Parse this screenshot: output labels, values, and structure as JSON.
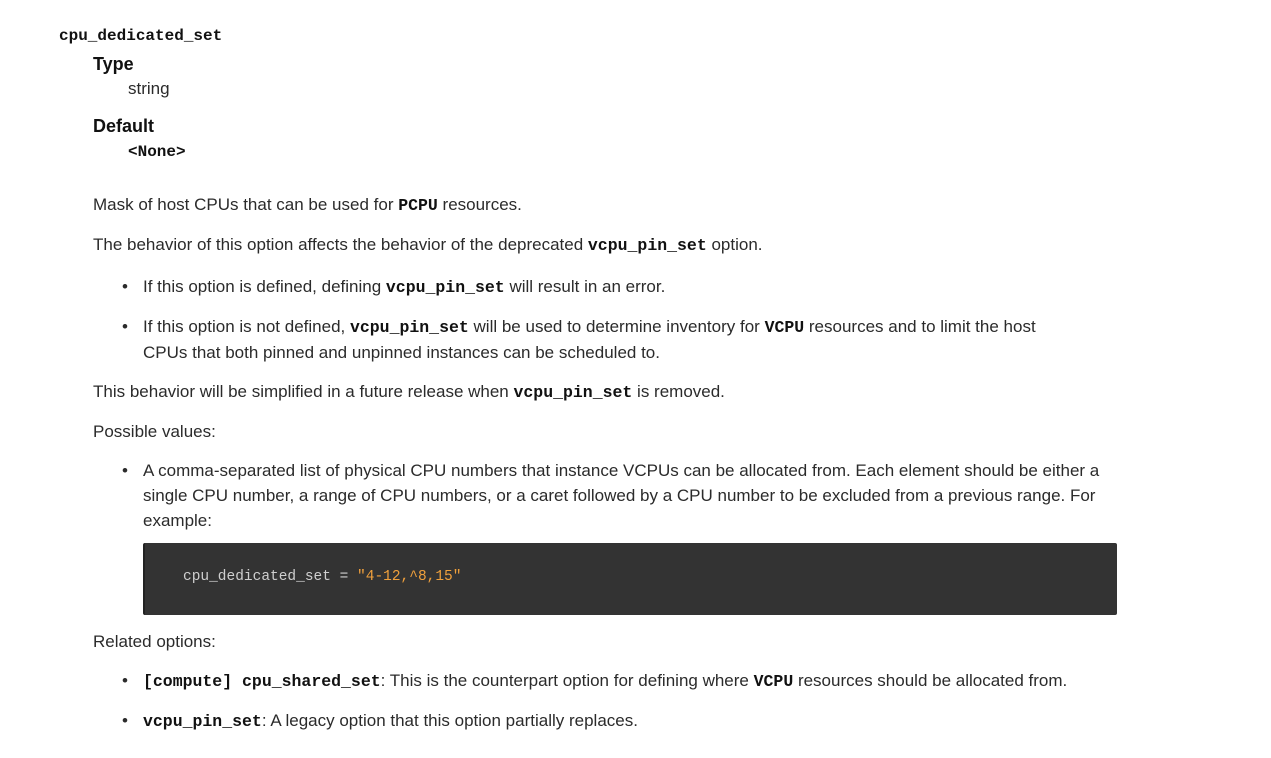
{
  "option": {
    "name": "cpu_dedicated_set",
    "type_label": "Type",
    "type_value": "string",
    "default_label": "Default",
    "default_value": "<None>"
  },
  "para1": {
    "before": "Mask of host CPUs that can be used for ",
    "code": "PCPU",
    "after": " resources."
  },
  "para2": {
    "before": "The behavior of this option affects the behavior of the deprecated ",
    "code": "vcpu_pin_set",
    "after": " option."
  },
  "bullets1": [
    {
      "before": "If this option is defined, defining ",
      "code": "vcpu_pin_set",
      "after": " will result in an error."
    },
    {
      "before": "If this option is not defined, ",
      "code": "vcpu_pin_set",
      "mid": " will be used to determine inventory for ",
      "code2": "VCPU",
      "after": " resources and to limit the host",
      "line2": "CPUs that both pinned and unpinned instances can be scheduled to."
    }
  ],
  "para3": {
    "before": "This behavior will be simplified in a future release when ",
    "code": "vcpu_pin_set",
    "after": " is removed."
  },
  "possible_values_label": "Possible values:",
  "possible_values_item": {
    "line1": "A comma-separated list of physical CPU numbers that instance VCPUs can be allocated from. Each element should be either a",
    "line2": "single CPU number, a range of CPU numbers, or a caret followed by a CPU number to be excluded from a previous range. For",
    "line3": "example:"
  },
  "code_example": {
    "key": "cpu_dedicated_set",
    "op": " = ",
    "value": "\"4-12,^8,15\""
  },
  "related_label": "Related options:",
  "related": [
    {
      "code": "[compute] cpu_shared_set",
      "before": ": This is the counterpart option for defining where ",
      "code2": "VCPU",
      "after": " resources should be allocated from."
    },
    {
      "code": "vcpu_pin_set",
      "after": ": A legacy option that this option partially replaces."
    }
  ],
  "bullet_glyph": "•"
}
